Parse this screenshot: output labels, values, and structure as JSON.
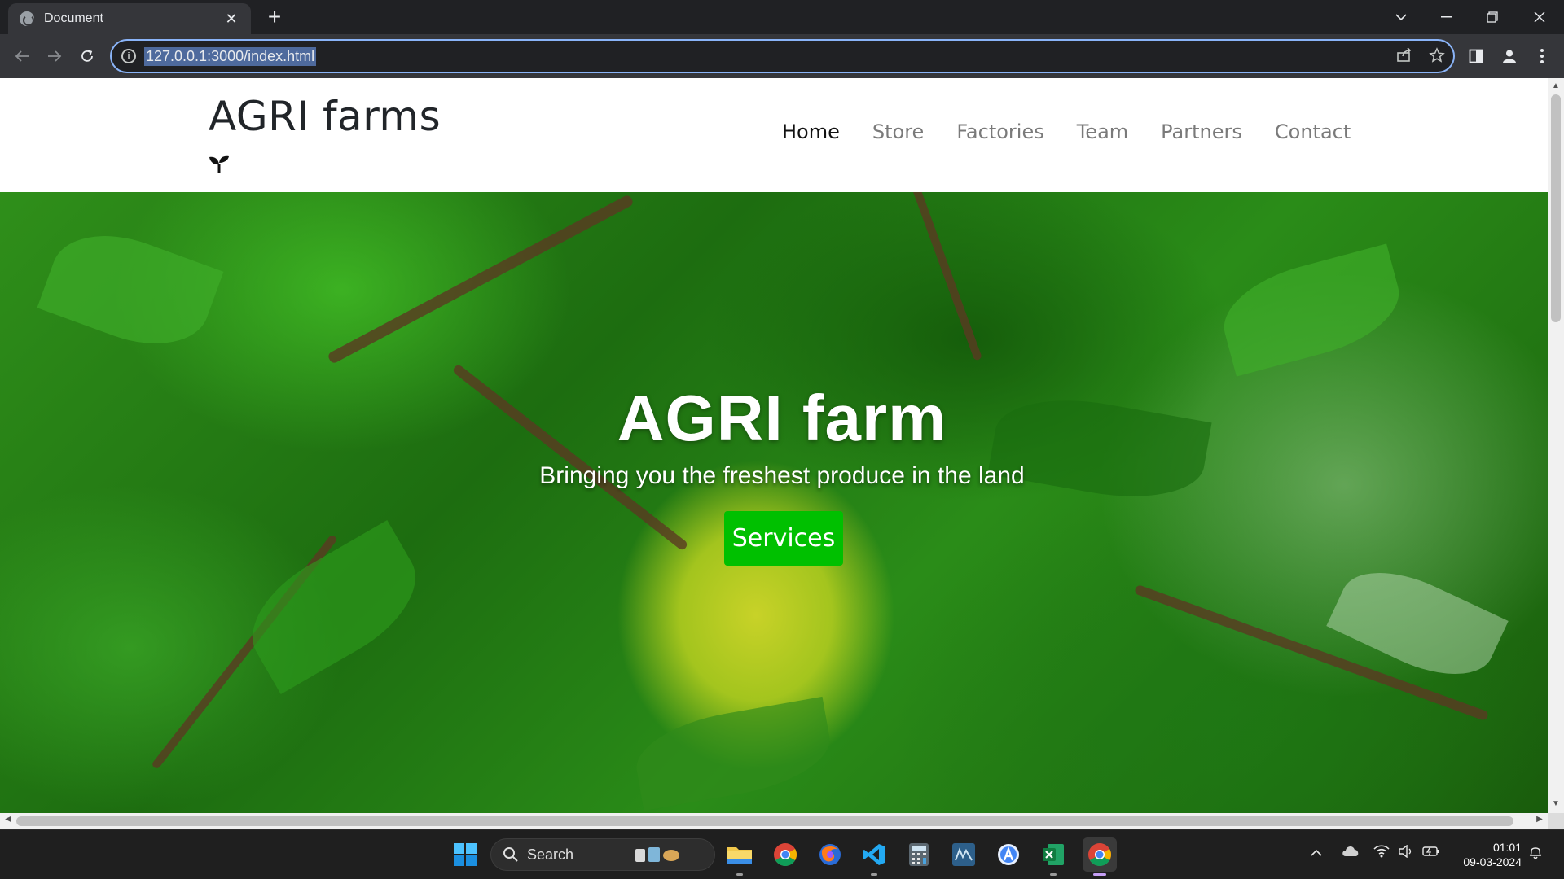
{
  "browser": {
    "tab_title": "Document",
    "tab_close": "✕",
    "new_tab": "+",
    "url": "127.0.0.1:3000/index.html"
  },
  "site": {
    "brand": "AGRI farms",
    "nav": [
      {
        "label": "Home",
        "active": true
      },
      {
        "label": "Store",
        "active": false
      },
      {
        "label": "Factories",
        "active": false
      },
      {
        "label": "Team",
        "active": false
      },
      {
        "label": "Partners",
        "active": false
      },
      {
        "label": "Contact",
        "active": false
      }
    ],
    "hero": {
      "title": "AGRI farm",
      "subtitle": "Bringing you the freshest produce in the land",
      "button": "Services"
    },
    "colors": {
      "accent_button": "#00c000",
      "header_bg": "#ffffff",
      "nav_active": "#111111",
      "nav_inactive": "#7a7a7a"
    }
  },
  "taskbar": {
    "search_label": "Search",
    "time": "01:01",
    "date": "09-03-2024",
    "apps": [
      "windows-start",
      "file-explorer",
      "chrome",
      "firefox-dev",
      "vs-code",
      "calculator",
      "mysql-workbench",
      "android-studio",
      "excel",
      "chrome-active"
    ]
  }
}
